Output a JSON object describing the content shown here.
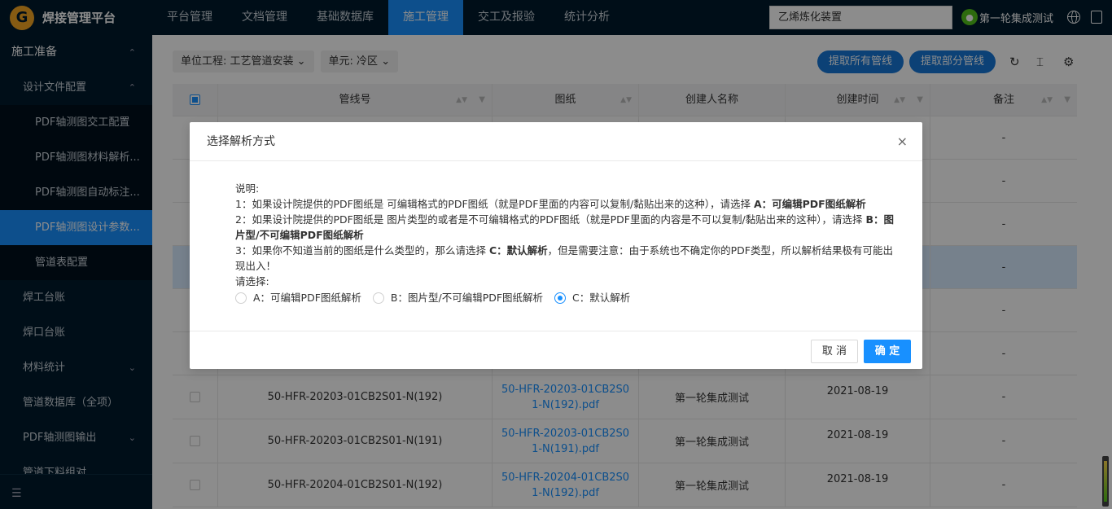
{
  "app": {
    "logo_letter": "G",
    "title": "焊接管理平台"
  },
  "nav": {
    "items": [
      "平台管理",
      "文档管理",
      "基础数据库",
      "施工管理",
      "交工及报验",
      "统计分析"
    ],
    "active_index": 3
  },
  "header": {
    "project": "乙烯炼化装置",
    "user": "第一轮集成测试"
  },
  "sidebar": {
    "items": [
      {
        "label": "施工准备",
        "level": 1,
        "chevron": "⌃"
      },
      {
        "label": "设计文件配置",
        "level": 2,
        "chevron": "⌃"
      },
      {
        "label": "PDF轴测图交工配置",
        "level": 3
      },
      {
        "label": "PDF轴测图材料解析...",
        "level": 3
      },
      {
        "label": "PDF轴测图自动标注...",
        "level": 3
      },
      {
        "label": "PDF轴测图设计参数...",
        "level": 3,
        "active": true
      },
      {
        "label": "管道表配置",
        "level": 3
      },
      {
        "label": "焊工台账",
        "level": 2
      },
      {
        "label": "焊口台账",
        "level": 2
      },
      {
        "label": "材料统计",
        "level": 2,
        "chevron": "⌄"
      },
      {
        "label": "管道数据库（全项）",
        "level": 2
      },
      {
        "label": "PDF轴测图输出",
        "level": 2,
        "chevron": "⌄"
      },
      {
        "label": "管道下料组对",
        "level": 2
      }
    ]
  },
  "toolbar": {
    "unit_project": "单位工程: 工艺管道安装 ⌄",
    "unit": "单元: 冷区 ⌄",
    "extract_all": "提取所有管线",
    "extract_part": "提取部分管线"
  },
  "table": {
    "columns": [
      "",
      "管线号",
      "图纸",
      "创建人名称",
      "创建时间",
      "备注"
    ],
    "rows": [
      {
        "line": "",
        "drawing": "",
        "creator": "",
        "date": "",
        "remark": "-"
      },
      {
        "line": "",
        "drawing": "",
        "creator": "",
        "date": "",
        "remark": "-"
      },
      {
        "line": "",
        "drawing": "",
        "creator": "",
        "date": "",
        "remark": "-"
      },
      {
        "line": "",
        "drawing": "",
        "creator": "",
        "date": "",
        "remark": "-"
      },
      {
        "line": "",
        "drawing": "",
        "creator": "",
        "date": "",
        "remark": "-"
      },
      {
        "line": "",
        "drawing": "",
        "creator": "",
        "date": "",
        "remark": "-"
      },
      {
        "line": "50-HFR-20203-01CB2S01-N(192)",
        "drawing": "50-HFR-20203-01CB2S01-N(192).pdf",
        "creator": "第一轮集成测试",
        "date": "2021-08-19",
        "remark": "-"
      },
      {
        "line": "50-HFR-20203-01CB2S01-N(191)",
        "drawing": "50-HFR-20203-01CB2S01-N(191).pdf",
        "creator": "第一轮集成测试",
        "date": "2021-08-19",
        "remark": "-"
      },
      {
        "line": "50-HFR-20204-01CB2S01-N(192)",
        "drawing": "50-HFR-20204-01CB2S01-N(192).pdf",
        "creator": "第一轮集成测试",
        "date": "2021-08-19",
        "remark": "-"
      }
    ]
  },
  "modal": {
    "title": "选择解析方式",
    "close": "×",
    "desc_label": "说明:",
    "line1_a": "1：如果设计院提供的PDF图纸是 可编辑格式的PDF图纸（就是PDF里面的内容可以复制/黏贴出来的这种），请选择 ",
    "line1_b": "A：可编辑PDF图纸解析",
    "line2_a": "2：如果设计院提供的PDF图纸是 图片类型的或者是不可编辑格式的PDF图纸（就是PDF里面的内容是不可以复制/黏贴出来的这种），请选择 ",
    "line2_b": "B：图片型/不可编辑PDF图纸解析",
    "line3_a": "3：如果你不知道当前的图纸是什么类型的，那么请选择 ",
    "line3_b": "C：默认解析",
    "line3_c": "，但是需要注意：由于系统也不确定你的PDF类型，所以解析结果极有可能出现出入！",
    "choose_label": "请选择:",
    "options": [
      "A：可编辑PDF图纸解析",
      "B：图片型/不可编辑PDF图纸解析",
      "C：默认解析"
    ],
    "selected_index": 2,
    "cancel": "取 消",
    "ok": "确 定"
  }
}
